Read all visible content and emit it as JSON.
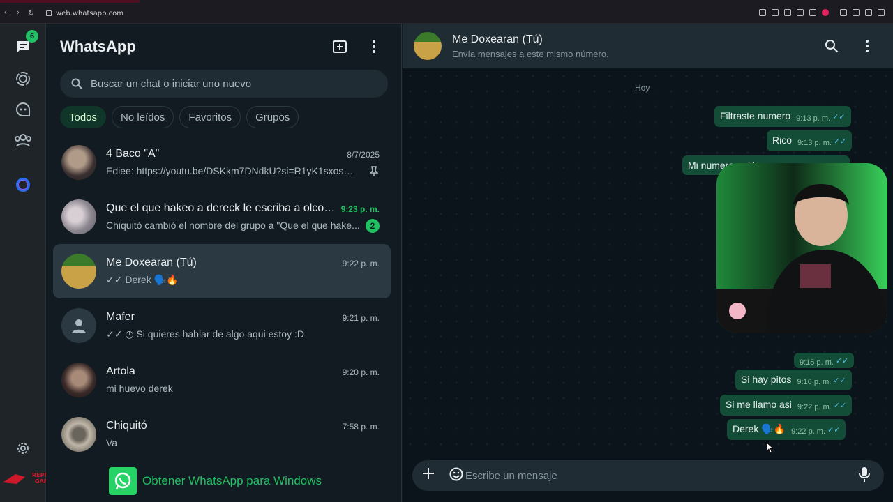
{
  "browser": {
    "url": "web.whatsapp.com"
  },
  "rail": {
    "chats_badge": "6",
    "items": [
      "chats-icon",
      "status-icon",
      "channels-icon",
      "communities-icon",
      "meta-ai-icon",
      "settings-icon"
    ],
    "brand_logo": "REPUBLIC OF GAMERS"
  },
  "sidebar": {
    "title": "WhatsApp",
    "search_placeholder": "Buscar un chat o iniciar uno nuevo",
    "filters": [
      "Todos",
      "No leídos",
      "Favoritos",
      "Grupos"
    ],
    "chats": [
      {
        "name": "4 Baco \"A\"",
        "time": "8/7/2025",
        "preview": "Ediee: https://youtu.be/DSKkm7DNdkU?si=R1yK1sxosWf...",
        "pinned": true
      },
      {
        "name": "Que el que hakeo a dereck le escriba a olcot ...",
        "time": "9:23 p. m.",
        "preview": "Chiquitó cambió el nombre del grupo a \"Que el que hake...",
        "unread": "2"
      },
      {
        "name": "Me Doxearan (Tú)",
        "time": "9:22 p. m.",
        "preview": "✓✓ Derek 🗣️🔥",
        "selected": true
      },
      {
        "name": "Mafer",
        "time": "9:21 p. m.",
        "preview": "✓✓ ◷ Si quieres hablar de algo aqui estoy :D"
      },
      {
        "name": "Artola",
        "time": "9:20 p. m.",
        "preview": "mi huevo derek"
      },
      {
        "name": "Chiquitó",
        "time": "7:58 p. m.",
        "preview": "Va"
      }
    ],
    "promo": "Obtener WhatsApp para Windows"
  },
  "chat": {
    "name": "Me Doxearan (Tú)",
    "subtitle": "Envía mensajes a este mismo número.",
    "day_label": "Hoy",
    "messages": [
      {
        "text": "Filtraste numero",
        "time": "9:13 p. m."
      },
      {
        "text": "Rico",
        "time": "9:13 p. m."
      },
      {
        "text": "Mi numero ... filtra...",
        "time": ""
      },
      {
        "text": "",
        "time": "9:15 p. m."
      },
      {
        "text": "Si hay pitos",
        "time": "9:16 p. m."
      },
      {
        "text": "Si me llamo asi",
        "time": "9:22 p. m."
      },
      {
        "text": "Derek 🗣️🔥",
        "time": "9:22 p. m."
      }
    ],
    "composer_placeholder": "Escribe un mensaje"
  }
}
